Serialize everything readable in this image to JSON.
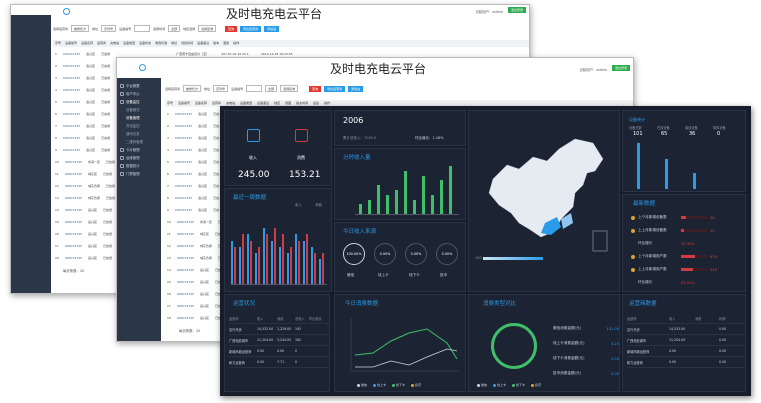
{
  "app_title": "及时电充电云平台",
  "back_window": {
    "header_user": "当前用户：admin",
    "logout_label": "退出登录",
    "filters": [
      "选择运营商",
      "被委托方",
      "地址",
      "序列号",
      "设备编号"
    ],
    "date_label": "选择时间",
    "date_value": "全部",
    "location_label": "地区选择",
    "location_value": "选择区域",
    "buttons": {
      "search": "查询",
      "export": "导出运营商",
      "add": "添加站"
    },
    "columns": [
      "序号",
      "设备编号",
      "设备名称",
      "运营商",
      "充电站",
      "设备类型",
      "设备状态",
      "收费标准",
      "地址",
      "创建时间",
      "设备备注",
      "版本",
      "更新",
      "操作"
    ],
    "rows": [
      [
        "1",
        "905070345",
        "嘉兴区",
        "已启用"
      ],
      [
        "2",
        "905070345",
        "嘉兴区",
        "已启用"
      ],
      [
        "3",
        "905070345",
        "嘉兴区",
        "已启用"
      ],
      [
        "4",
        "905070345",
        "嘉兴区",
        "已启用"
      ],
      [
        "5",
        "905070345",
        "嘉兴区",
        "已启用"
      ],
      [
        "6",
        "905070345",
        "嘉兴区",
        "已启用"
      ],
      [
        "7",
        "905070345",
        "嘉兴区",
        "已启用"
      ],
      [
        "8",
        "905070345",
        "嘉兴区",
        "已启用"
      ],
      [
        "9",
        "905070345",
        "嘉兴区",
        "已启用"
      ],
      [
        "10",
        "905070345",
        "青海一区",
        "已启用"
      ],
      [
        "11",
        "905070345",
        "城东区",
        "已启用"
      ],
      [
        "12",
        "905070345",
        "城东仓库",
        "已启用"
      ],
      [
        "13",
        "905070345",
        "城东仓库",
        "已启用"
      ],
      [
        "14",
        "905070345",
        "嘉兴区",
        "已启用"
      ],
      [
        "15",
        "905070345",
        "嘉兴区",
        "已启用"
      ],
      [
        "16",
        "905070345",
        "嘉兴区",
        "已启用"
      ],
      [
        "17",
        "905070345",
        "嘉兴区",
        "已启用"
      ],
      [
        "18",
        "905070345",
        "嘉兴区",
        "已启用"
      ]
    ],
    "first_row_extra": "广西南宁自由定价（空）",
    "first_row_date": "327.07.02 22.33.1",
    "first_row_time": "2019-12-18 16:20:55",
    "pagination": "每页条数：20"
  },
  "mid_window": {
    "header_user": "当前用户：admin",
    "logout_label": "退出登录",
    "filters": [
      "选择运营商",
      "被委托方",
      "地址",
      "序列号",
      "设备编号"
    ],
    "date_value": "全部",
    "location_value": "选择区域",
    "buttons": {
      "search": "查询",
      "export": "导出运营商",
      "add": "添加站"
    },
    "columns": [
      "序号",
      "设备编号",
      "设备名称",
      "运营商",
      "充电站",
      "设备类型",
      "设备备注",
      "地区",
      "视图",
      "提交时间",
      "最后",
      "操作"
    ],
    "rows": [
      [
        "1",
        "905070345",
        "嘉兴区",
        "已启"
      ],
      [
        "2",
        "905070345",
        "嘉兴区",
        "已启"
      ],
      [
        "3",
        "905070345",
        "嘉兴区",
        "已启"
      ],
      [
        "4",
        "905070345",
        "嘉兴区",
        "已启"
      ],
      [
        "5",
        "905070345",
        "嘉兴区",
        "已启"
      ],
      [
        "6",
        "905070345",
        "嘉兴区",
        "已启"
      ],
      [
        "7",
        "905070345",
        "嘉兴区",
        "已启"
      ],
      [
        "8",
        "905070345",
        "嘉兴区",
        "已启"
      ],
      [
        "9",
        "905070345",
        "嘉兴区",
        "已启"
      ],
      [
        "10",
        "905070345",
        "青海一区",
        "已启"
      ],
      [
        "11",
        "905070345",
        "城东区",
        "已启"
      ],
      [
        "12",
        "905070345",
        "城东仓库",
        "已启"
      ],
      [
        "13",
        "905070345",
        "城东仓库",
        "已启"
      ],
      [
        "14",
        "905070345",
        "嘉兴区",
        "已启"
      ],
      [
        "15",
        "905070345",
        "嘉兴区",
        "已启"
      ],
      [
        "16",
        "905070345",
        "嘉兴区",
        "已启"
      ],
      [
        "17",
        "905070345",
        "嘉兴区",
        "已启"
      ],
      [
        "18",
        "905070345",
        "嘉兴区",
        "已启"
      ]
    ],
    "first_row_time": "2019-11-14 14:46:41",
    "first_row_date": "2019-12-19 16:07:3",
    "pagination": "每页条数：20"
  },
  "sidebar": [
    {
      "label": "平台概要",
      "type": "top"
    },
    {
      "label": "用户中心",
      "type": "top"
    },
    {
      "label": "设备监控",
      "type": "top",
      "selected": true
    },
    {
      "label": "设备概况",
      "type": "sub"
    },
    {
      "label": "设备管理",
      "type": "sub",
      "selected": true
    },
    {
      "label": "充电监控",
      "type": "sub"
    },
    {
      "label": "通讯记录",
      "type": "sub"
    },
    {
      "label": "二维码管理",
      "type": "sub"
    },
    {
      "label": "卡片管理",
      "type": "top"
    },
    {
      "label": "运维管理",
      "type": "top"
    },
    {
      "label": "数据统计",
      "type": "top"
    },
    {
      "label": "门禁管理",
      "type": "top"
    }
  ],
  "dashboard": {
    "income_label": "收入",
    "income_value": "245.00",
    "consume_label": "消费",
    "consume_value": "153.21",
    "recent_title": "最近一周数据",
    "recent_legend": [
      "收入",
      "消费"
    ],
    "year_value": "2006",
    "accum_label": "累计总收入：7045.5",
    "ratio_label": "环比增长：1.26%",
    "hourly_title": "分时收入量",
    "sources_title": "今日收入来源",
    "sources": [
      {
        "pct": "100.00%",
        "label": "微信"
      },
      {
        "pct": "0.00%",
        "label": "线上卡"
      },
      {
        "pct": "0.00%",
        "label": "线下卡"
      },
      {
        "pct": "0.00%",
        "label": "投币"
      }
    ],
    "map_legend_min": "100",
    "device_title": "设备统计",
    "device_stats": [
      {
        "label": "设备总数",
        "value": "101"
      },
      {
        "label": "在线设备",
        "value": "65"
      },
      {
        "label": "离线设备",
        "value": "36"
      },
      {
        "label": "故障设备",
        "value": "0"
      }
    ],
    "device_date": "统计时间：2017-08-03",
    "latest_title": "最新数据",
    "latest": [
      {
        "label": "上个月新增设备数",
        "value": "38",
        "fill": 0.2
      },
      {
        "label": "上上月新增设备数",
        "value": "22",
        "fill": 0.12
      },
      {
        "label": "环比增长",
        "value": "19.35%",
        "fill": null
      },
      {
        "label": "上个月新增用户数",
        "value": "676",
        "fill": 0.55
      },
      {
        "label": "上上月新增用户数",
        "value": "548",
        "fill": 0.45
      },
      {
        "label": "环比增长",
        "value": "23.91%",
        "fill": null
      }
    ],
    "ops_title": "运营状况",
    "ops_columns": [
      "运营商",
      "收入",
      "消费",
      "总收入",
      "环比增长"
    ],
    "ops_rows": [
      [
        "嘉兴光伏",
        "14,532.00",
        "1,229.00",
        "192",
        ""
      ],
      [
        "广西电影城市",
        "11,204.00",
        "3,244.00",
        "182",
        ""
      ],
      [
        "新城商城运营商",
        "0.00",
        "0.00",
        "0",
        ""
      ],
      [
        "和力运营商",
        "0.00",
        "7.71",
        "0",
        ""
      ]
    ],
    "today_title": "今日消费数据",
    "today_legend": [
      "微信",
      "线上卡",
      "线下卡",
      "投币"
    ],
    "ratio_title": "消费类型对比",
    "ratio_legend": [
      "微信",
      "线上卡",
      "线下卡",
      "投币"
    ],
    "ratio_items": [
      {
        "label": "微信消费金额(元)",
        "value": "141.00"
      },
      {
        "label": "线上卡消费金额(元)",
        "value": "3.25"
      },
      {
        "label": "线下卡消费金额(元)",
        "value": "2.94"
      },
      {
        "label": "投币消费金额(元)",
        "value": "0.00"
      }
    ],
    "ops2_title": "运营商数据",
    "ops2_columns": [
      "运营商",
      "收入",
      "消费",
      "利润"
    ],
    "ops2_rows": [
      [
        "嘉兴光伏",
        "14,532.00",
        "",
        "0.00"
      ],
      [
        "广西电影城市",
        "11,204.00",
        "",
        "0.00"
      ],
      [
        "新城商城运营商",
        "0.00",
        "",
        "0.00"
      ],
      [
        "和力运营商",
        "0.00",
        "",
        "0.00"
      ]
    ],
    "colors": {
      "accent": "#2a9be8",
      "red": "#d23b44",
      "green": "#3fbf6a"
    }
  },
  "chart_data": [
    {
      "type": "bar",
      "title": "最近一周数据",
      "series": [
        {
          "name": "收入",
          "values": [
            7,
            6,
            8,
            5,
            9,
            7,
            6,
            5,
            8,
            7,
            6,
            4
          ]
        },
        {
          "name": "消费",
          "values": [
            6,
            8,
            7,
            6,
            8,
            9,
            8,
            6,
            7,
            8,
            5,
            5
          ]
        }
      ]
    },
    {
      "type": "bar",
      "title": "分时收入量",
      "values": [
        2,
        3,
        6,
        4,
        5,
        9,
        3,
        8,
        4,
        7,
        10
      ]
    },
    {
      "type": "bar",
      "title": "设备统计",
      "values": [
        101,
        65,
        36,
        0
      ]
    }
  ]
}
